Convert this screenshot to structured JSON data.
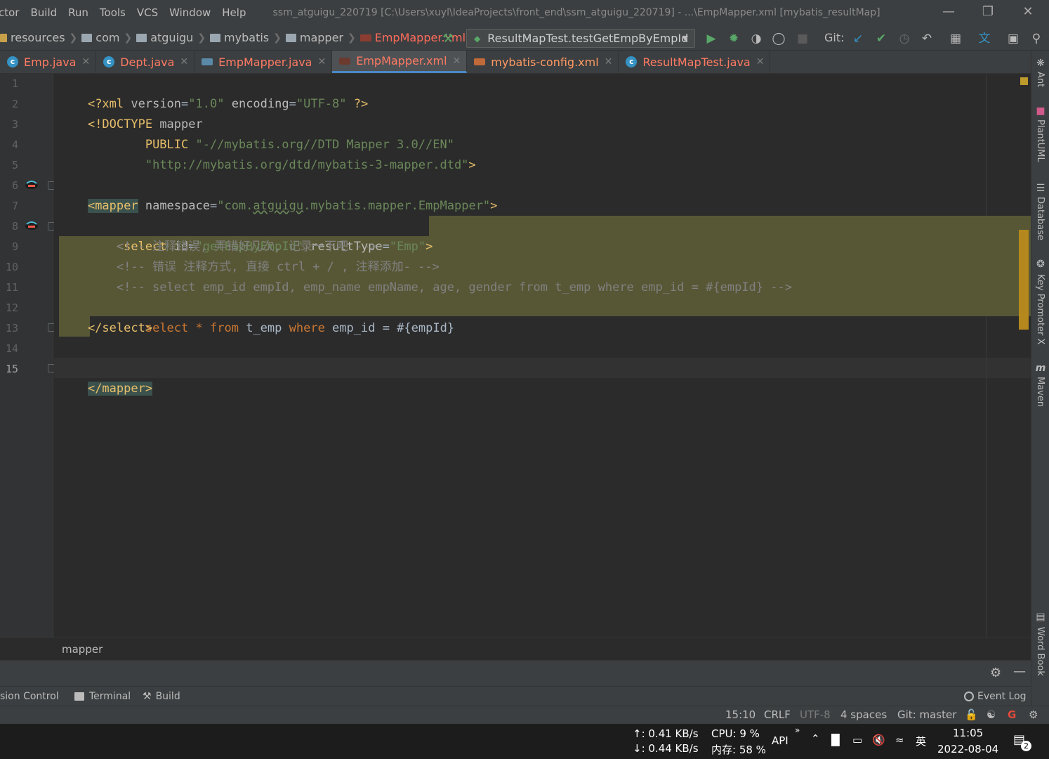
{
  "menu": [
    "ctor",
    "Build",
    "Run",
    "Tools",
    "VCS",
    "Window",
    "Help"
  ],
  "window_title": "ssm_atguigu_220719 [C:\\Users\\xuyl\\IdeaProjects\\front_end\\ssm_atguigu_220719] - ...\\EmpMapper.xml [mybatis_resultMap]",
  "breadcrumbs": [
    "resources",
    "com",
    "atguigu",
    "mybatis",
    "mapper",
    "EmpMapper.xml"
  ],
  "run_config": "ResultMapTest.testGetEmpByEmpId",
  "git_label": "Git:",
  "tabs": [
    {
      "label": "Emp.java",
      "icon": "class-icon"
    },
    {
      "label": "Dept.java",
      "icon": "class-icon"
    },
    {
      "label": "EmpMapper.java",
      "icon": "mybatis-icon"
    },
    {
      "label": "EmpMapper.xml",
      "icon": "mybatis-icon",
      "active": true
    },
    {
      "label": "mybatis-config.xml",
      "icon": "xml-config-icon"
    },
    {
      "label": "ResultMapTest.java",
      "icon": "test-class-icon"
    }
  ],
  "line_numbers": [
    "1",
    "2",
    "3",
    "4",
    "5",
    "6",
    "7",
    "8",
    "9",
    "10",
    "11",
    "12",
    "13",
    "14",
    "15"
  ],
  "code": {
    "l1": {
      "a": "<?xml ",
      "b": "version",
      "c": "=",
      "d": "\"1.0\"",
      "e": " ",
      "f": "encoding",
      "g": "=",
      "h": "\"UTF-8\"",
      "i": " ?>"
    },
    "l2": {
      "a": "<!DOCTYPE ",
      "b": "mapper"
    },
    "l3": {
      "a": "        PUBLIC ",
      "b": "\"-//mybatis.org//DTD Mapper 3.0//EN\""
    },
    "l4": {
      "a": "        ",
      "b": "\"http://mybatis.org/dtd/mybatis-3-mapper.dtd\"",
      "c": ">"
    },
    "l6": {
      "a": "<mapper",
      "b": " namespace",
      "c": "=",
      "d": "\"com.",
      "e": "atguigu",
      "f": ".mybatis.mapper.EmpMapper\"",
      "g": ">"
    },
    "l8": {
      "a": "    <select",
      "b": " id",
      "c": "=",
      "d": "\"getEmpByEmpId\"",
      "e": " resultType",
      "f": "=",
      "g": "\"Emp\"",
      "h": ">"
    },
    "l9": "        <!-- 注释错误, 弄错好几次, 记录一下吧 -->",
    "l10": "        <!-- 错误 注释方式, 直接 ctrl + / , 注释添加- -->",
    "l11": "        <!-- select emp_id empId, emp_name empName, age, gender from t_emp where emp_id = #{empId} -->",
    "l12": {
      "a": "        ",
      "b": "select",
      "c": " ",
      "d": "*",
      "e": " ",
      "f": "from",
      "g": " t_emp ",
      "h": "where",
      "i": " emp_id = #{empId}"
    },
    "l13": "    </select>",
    "l15": "</mapper>"
  },
  "editor_breadcrumb": "mapper",
  "bottom_tools": [
    "sion Control",
    "Terminal",
    "Build"
  ],
  "event_log": "Event Log",
  "status": {
    "position": "15:10",
    "line_sep": "CRLF",
    "encoding": "UTF-8",
    "indent": "4 spaces",
    "vcs": "Git: master"
  },
  "right_tools": [
    "Ant",
    "PlantUML",
    "Database",
    "Key Promoter X",
    "Maven",
    "Word Book"
  ],
  "taskbar": {
    "upload": "↑: 0.41 KB/s",
    "download": "↓: 0.44 KB/s",
    "cpu": "CPU: 9 %",
    "mem": "内存: 58 %",
    "api": "API",
    "ime": "英",
    "time": "11:05",
    "date": "2022-08-04",
    "notif_count": "2"
  },
  "colors": {
    "editor_bg": "#2b2b2b",
    "panel_bg": "#3c3f41",
    "selection": "#575736",
    "tag": "#e8bf6a",
    "string": "#6a8759",
    "keyword": "#cc7832",
    "comment": "#808080",
    "current_file": "#ff6b5b"
  }
}
